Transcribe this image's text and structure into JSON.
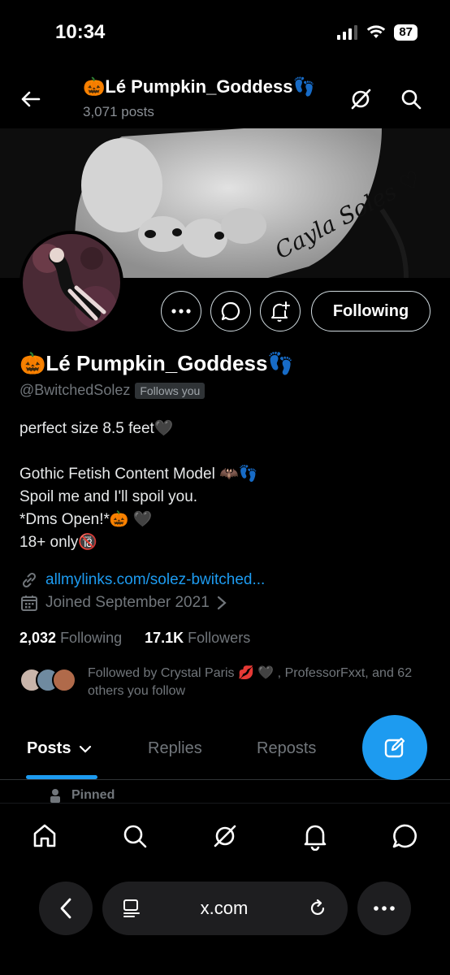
{
  "status_bar": {
    "time": "10:34",
    "battery": "87"
  },
  "header": {
    "title": "🎃Lé Pumpkin_Goddess👣",
    "posts_count": "3,071 posts"
  },
  "banner": {
    "signature_text": "Cayla Soles ♡"
  },
  "actions": {
    "following_label": "Following"
  },
  "profile": {
    "display_name": "🎃Lé Pumpkin_Goddess👣",
    "handle": "@BwitchedSolez",
    "follows_you": "Follows you",
    "bio": "perfect size 8.5 feet🖤\n\nGothic Fetish Content Model 🦇👣\nSpoil me and I'll spoil you.\n*Dms Open!*🎃 🖤\n18+ only🔞",
    "link": "allmylinks.com/solez-bwitched...",
    "joined": "Joined September 2021"
  },
  "stats": {
    "following_count": "2,032",
    "following_label": "Following",
    "followers_count": "17.1K",
    "followers_label": "Followers"
  },
  "followed_by": "Followed by Crystal Paris 💋 🖤 , ProfessorFxxt, and 62 others you follow",
  "tabs": [
    {
      "label": "Posts"
    },
    {
      "label": "Replies"
    },
    {
      "label": "Reposts"
    }
  ],
  "pinned_label": "Pinned",
  "browser": {
    "domain": "x.com"
  },
  "colors": {
    "accent": "#1d9bf0",
    "background": "#000000",
    "muted": "#71767b"
  }
}
